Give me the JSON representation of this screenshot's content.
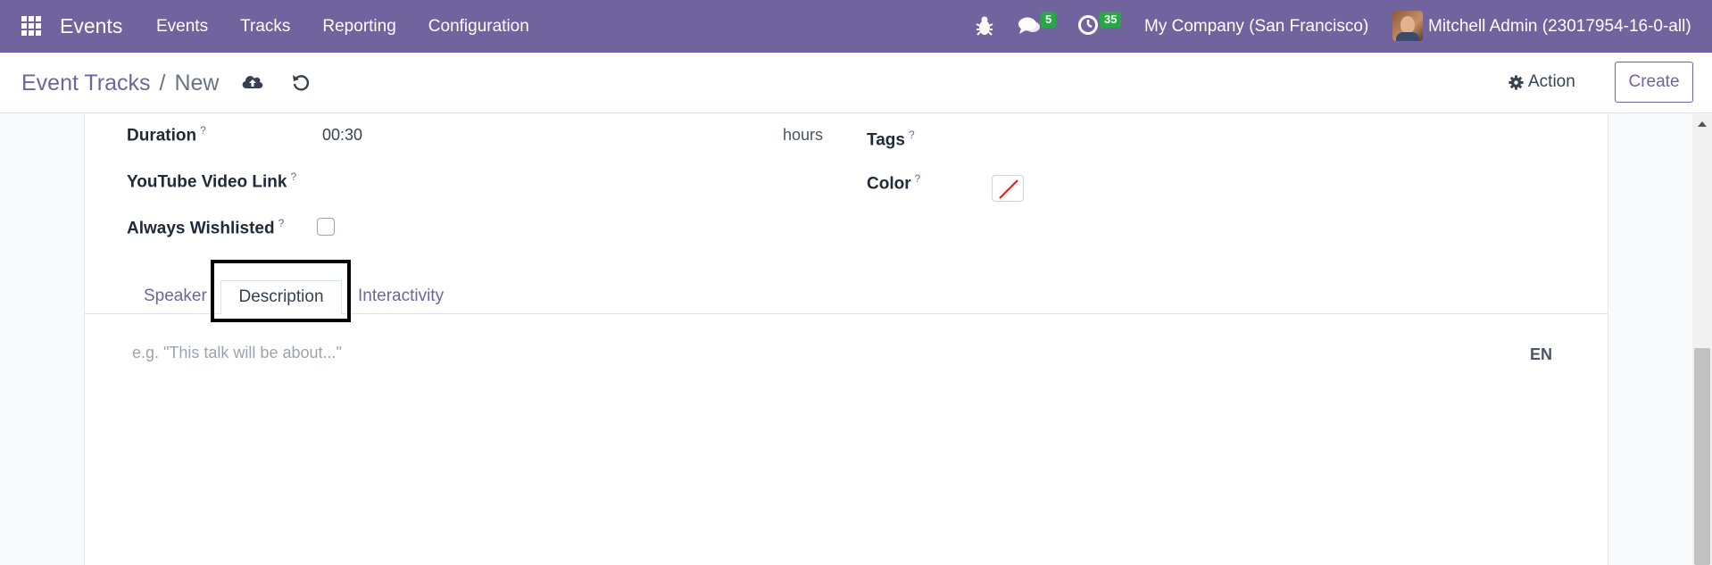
{
  "navbar": {
    "app_name": "Events",
    "menu": [
      "Events",
      "Tracks",
      "Reporting",
      "Configuration"
    ],
    "messages_count": "5",
    "activities_count": "35",
    "company": "My Company (San Francisco)",
    "user": "Mitchell Admin (23017954-16-0-all)",
    "color": "#71639e"
  },
  "control_panel": {
    "breadcrumb_parent": "Event Tracks",
    "breadcrumb_sep": "/",
    "breadcrumb_current": "New",
    "action_label": "Action",
    "create_label": "Create"
  },
  "form": {
    "duration_label": "Duration",
    "duration_value": "00:30",
    "duration_unit": "hours",
    "youtube_label": "YouTube Video Link",
    "wishlisted_label": "Always Wishlisted",
    "wishlisted_checked": false,
    "tags_label": "Tags",
    "color_label": "Color",
    "help_mark": "?"
  },
  "tabs": {
    "speaker": "Speaker",
    "description": "Description",
    "interactivity": "Interactivity",
    "active": "Description"
  },
  "description": {
    "placeholder": "e.g. \"This talk will be about...\"",
    "lang": "EN"
  }
}
